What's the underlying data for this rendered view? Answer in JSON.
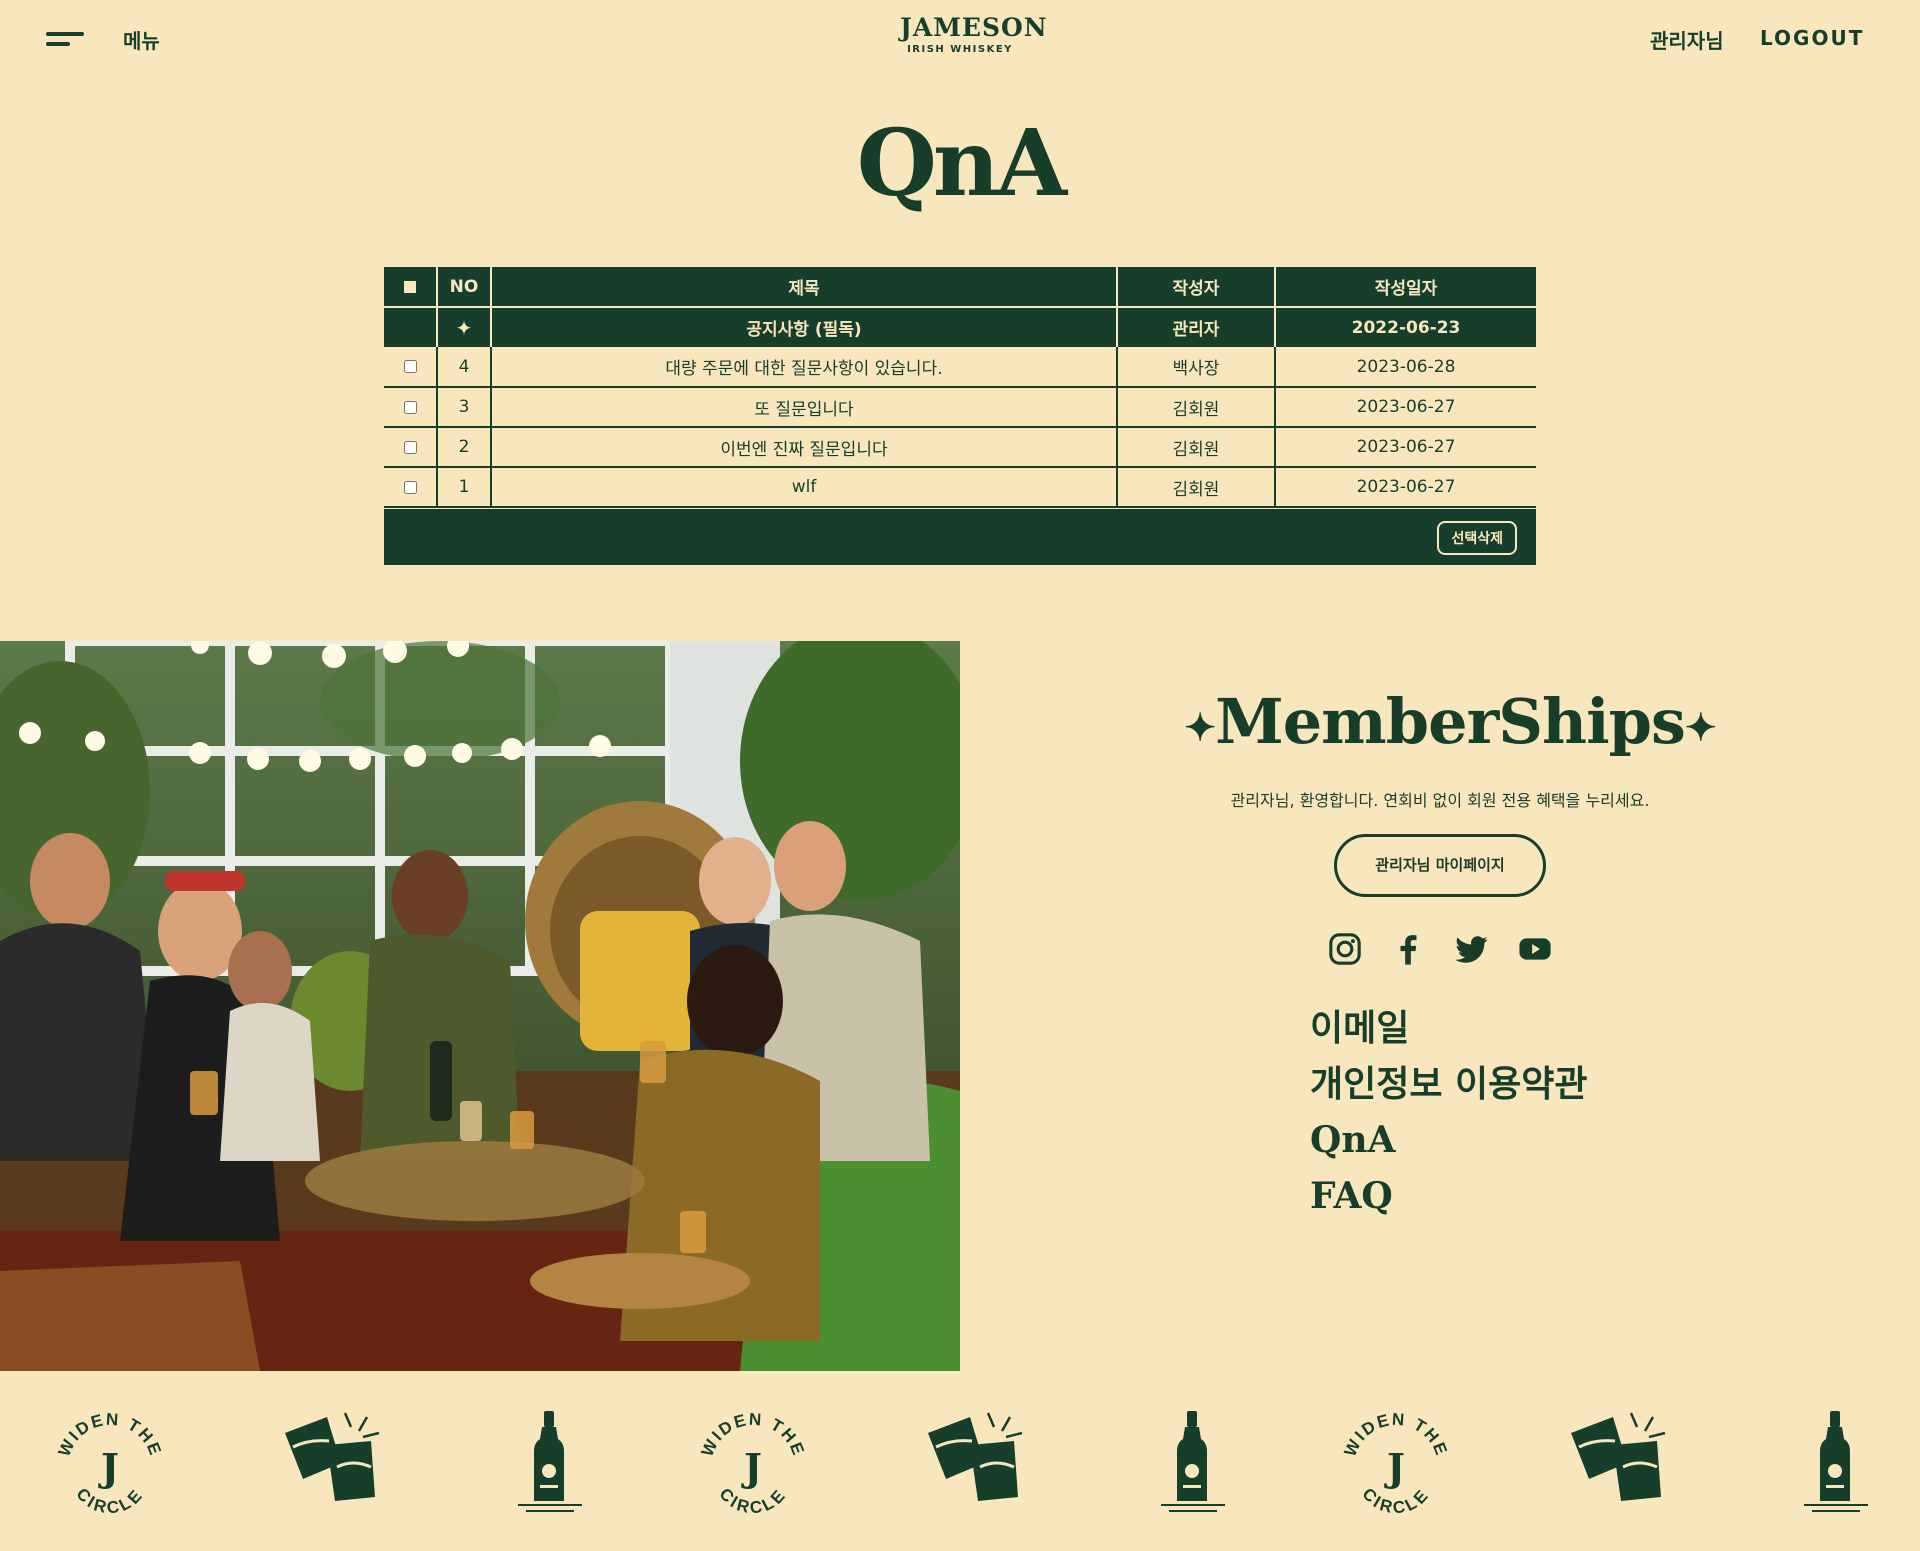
{
  "header": {
    "menu_label": "메뉴",
    "logo_main": "JAMESON",
    "logo_sub": "IRISH WHISKEY",
    "user_name": "관리자님",
    "logout_label": "LOGOUT"
  },
  "page": {
    "title": "QnA"
  },
  "table": {
    "columns": [
      "NO",
      "제목",
      "작성자",
      "작성일자"
    ],
    "notice": {
      "marker": "✦",
      "title": "공지사항 (필독)",
      "author": "관리자",
      "date": "2022-06-23"
    },
    "rows": [
      {
        "no": "4",
        "title": "대량 주문에 대한 질문사항이 있습니다.",
        "author": "백사장",
        "date": "2023-06-28"
      },
      {
        "no": "3",
        "title": "또 질문입니다",
        "author": "김회원",
        "date": "2023-06-27"
      },
      {
        "no": "2",
        "title": "이번엔 진짜 질문입니다",
        "author": "김회원",
        "date": "2023-06-27"
      },
      {
        "no": "1",
        "title": "wlf",
        "author": "김회원",
        "date": "2023-06-27"
      }
    ],
    "delete_label": "선택삭제"
  },
  "membership": {
    "title": "MemberShips",
    "sparkle": "✦",
    "welcome": "관리자님, 환영합니다. 연회비 없이 회원 전용 혜택을 누리세요.",
    "mypage_label": "관리자님 마이페이지",
    "social_icons": [
      "instagram-icon",
      "facebook-icon",
      "twitter-icon",
      "youtube-icon"
    ],
    "links": [
      "이메일",
      "개인정보 이용약관",
      "QnA",
      "FAQ"
    ]
  },
  "band": {
    "badge_top": "WIDEN THE",
    "badge_bottom": "CIRCLE",
    "badge_letter": "J",
    "pattern": [
      "widen-the-circle-badge",
      "toasting-glasses-icon",
      "whiskey-bottle-icon"
    ]
  },
  "colors": {
    "background": "#f8e7bd",
    "primary": "#173e2b"
  }
}
